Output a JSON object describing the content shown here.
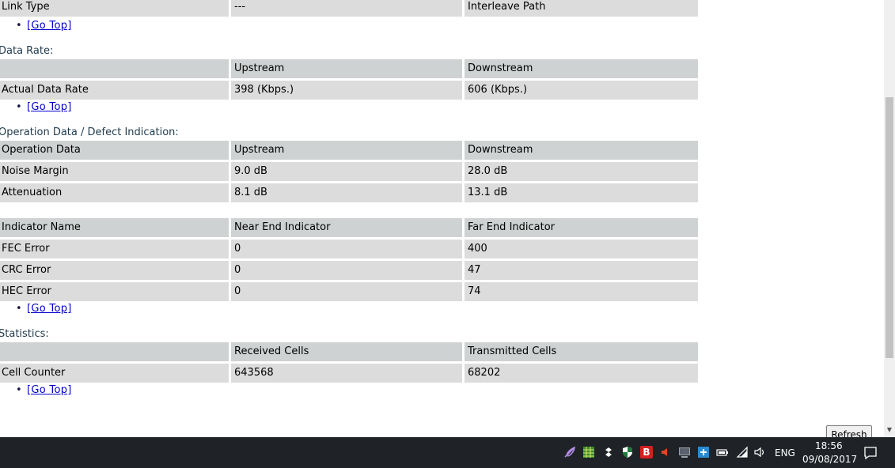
{
  "link_type_row": {
    "label": "Link Type",
    "upstream": "---",
    "downstream": "Interleave Path"
  },
  "go_top_label": "[Go Top]",
  "data_rate": {
    "title": "Data Rate:",
    "headers": [
      "",
      "Upstream",
      "Downstream"
    ],
    "rows": [
      [
        "Actual Data Rate",
        "398 (Kbps.)",
        "606 (Kbps.)"
      ]
    ]
  },
  "operation_data": {
    "title": "Operation Data / Defect Indication:",
    "headers": [
      "Operation Data",
      "Upstream",
      "Downstream"
    ],
    "rows": [
      [
        "Noise Margin",
        "9.0 dB",
        "28.0 dB"
      ],
      [
        "Attenuation",
        "8.1 dB",
        "13.1 dB"
      ]
    ]
  },
  "indicators": {
    "headers": [
      "Indicator Name",
      "Near End Indicator",
      "Far End Indicator"
    ],
    "rows": [
      [
        "FEC Error",
        "0",
        "400"
      ],
      [
        "CRC Error",
        "0",
        "47"
      ],
      [
        "HEC Error",
        "0",
        "74"
      ]
    ]
  },
  "statistics": {
    "title": "Statistics:",
    "headers": [
      "",
      "Received Cells",
      "Transmitted Cells"
    ],
    "rows": [
      [
        "Cell Counter",
        "643568",
        "68202"
      ]
    ]
  },
  "refresh_label": "Refresh",
  "taskbar": {
    "language": "ENG",
    "time": "18:56",
    "date": "09/08/2017",
    "tray_icons": [
      "feather-icon",
      "spreadsheet-icon",
      "dropbox-icon",
      "shield-icon",
      "bitdefender-icon",
      "speaker-alert-icon",
      "monitor-icon",
      "network-manager-icon",
      "battery-icon",
      "wifi-icon",
      "volume-icon"
    ]
  },
  "colors": {
    "header_bg": "#cfd2d2",
    "row_bg": "#dcdcdc",
    "link": "#0000cc",
    "taskbar_bg": "#1f2327"
  }
}
